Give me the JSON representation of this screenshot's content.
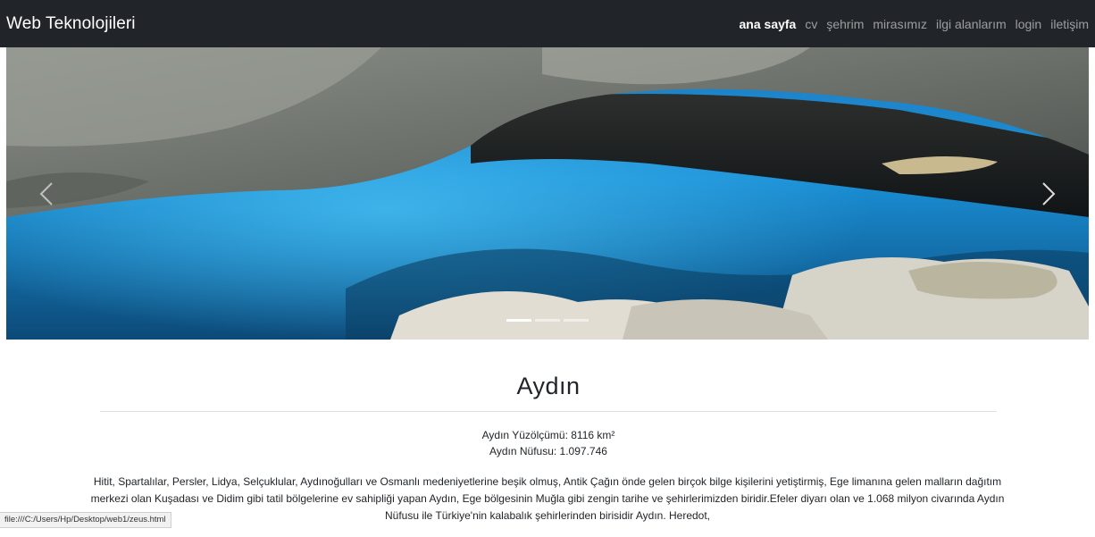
{
  "navbar": {
    "brand": "Web Teknolojileri",
    "links": [
      {
        "label": "ana sayfa"
      },
      {
        "label": "cv"
      },
      {
        "label": "şehrim"
      },
      {
        "label": "mirasımız"
      },
      {
        "label": "ilgi alanlarım"
      },
      {
        "label": "login"
      },
      {
        "label": "iletişim"
      }
    ]
  },
  "carousel": {
    "prev_icon": "chevron-left",
    "next_icon": "chevron-right"
  },
  "main": {
    "title": "Aydın",
    "area": "Aydın Yüzölçümü: 8116 km²",
    "population": "Aydın Nüfusu: 1.097.746",
    "paragraph": "Hitit, Spartalılar, Persler, Lidya, Selçuklular, Aydınoğulları ve Osmanlı medeniyetlerine beşik olmuş, Antik Çağın önde gelen birçok bilge kişilerini yetiştirmiş, Ege limanına gelen malların dağıtım merkezi olan Kuşadası ve Didim gibi tatil bölgelerine ev sahipliği yapan Aydın, Ege bölgesinin Muğla gibi zengin tarihe ve şehirlerimizden biridir.Efeler diyarı olan ve 1.068 milyon civarında Aydın Nüfusu ile Türkiye'nin kalabalık şehirlerinden birisidir Aydın. Heredot,"
  },
  "status_bar": {
    "url": "file:///C:/Users/Hp/Desktop/web1/zeus.html"
  }
}
